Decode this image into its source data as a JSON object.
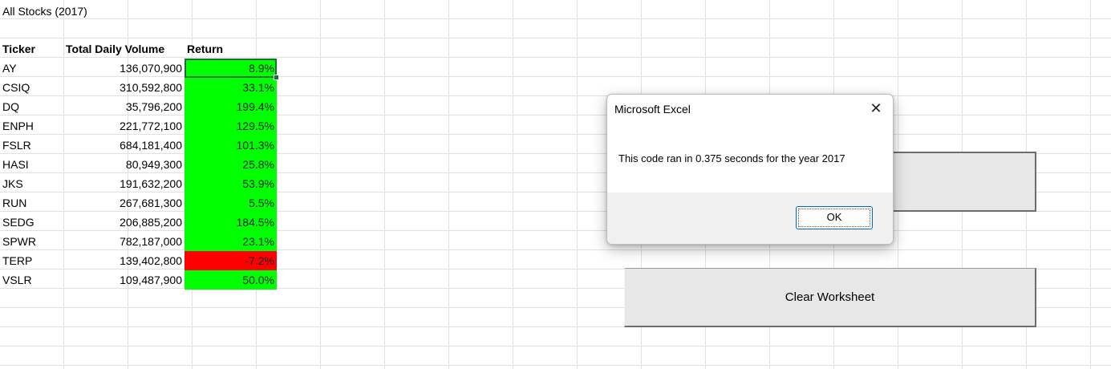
{
  "sheet": {
    "title": "All Stocks (2017)",
    "headers": {
      "ticker": "Ticker",
      "volume": "Total Daily Volume",
      "return": "Return"
    },
    "rows": [
      {
        "ticker": "AY",
        "volume": "136,070,900",
        "return": "8.9%"
      },
      {
        "ticker": "CSIQ",
        "volume": "310,592,800",
        "return": "33.1%"
      },
      {
        "ticker": "DQ",
        "volume": "35,796,200",
        "return": "199.4%"
      },
      {
        "ticker": "ENPH",
        "volume": "221,772,100",
        "return": "129.5%"
      },
      {
        "ticker": "FSLR",
        "volume": "684,181,400",
        "return": "101.3%"
      },
      {
        "ticker": "HASI",
        "volume": "80,949,300",
        "return": "25.8%"
      },
      {
        "ticker": "JKS",
        "volume": "191,632,200",
        "return": "53.9%"
      },
      {
        "ticker": "RUN",
        "volume": "267,681,300",
        "return": "5.5%"
      },
      {
        "ticker": "SEDG",
        "volume": "206,885,200",
        "return": "184.5%"
      },
      {
        "ticker": "SPWR",
        "volume": "782,187,000",
        "return": "23.1%"
      },
      {
        "ticker": "TERP",
        "volume": "139,402,800",
        "return": "-7.2%"
      },
      {
        "ticker": "VSLR",
        "volume": "109,487,900",
        "return": "50.0%"
      }
    ],
    "colors": {
      "positive_fill": "#00ff00",
      "negative_fill": "#ff0000",
      "selection": "#1e6b3c"
    },
    "clear_button_label": "Clear Worksheet"
  },
  "dialog": {
    "title": "Microsoft Excel",
    "message": "This code ran in 0.375 seconds for the year 2017",
    "ok_label": "OK",
    "close_icon": "close-icon"
  }
}
